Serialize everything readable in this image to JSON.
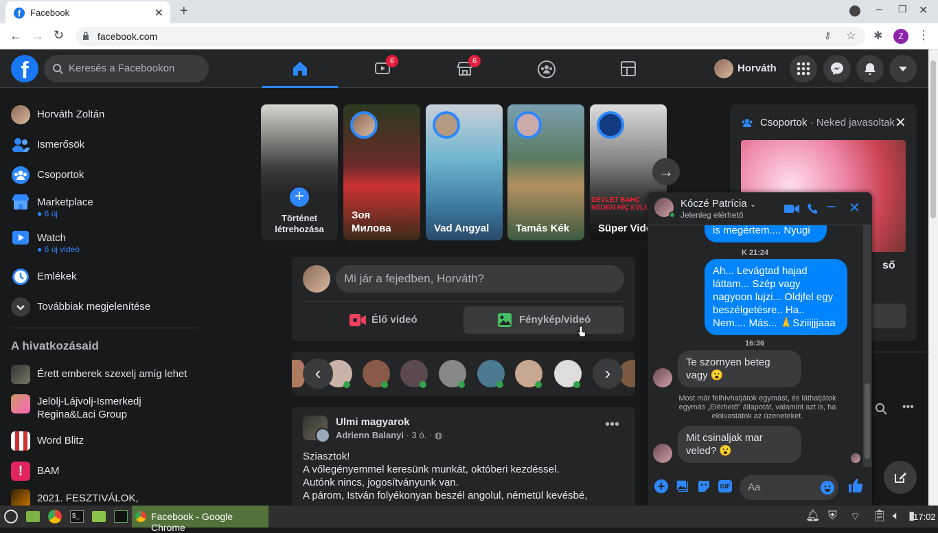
{
  "browser": {
    "tab_title": "Facebook",
    "url": "facebook.com",
    "profile_initial": "Z"
  },
  "header": {
    "search_placeholder": "Keresés a Facebookon",
    "watch_badge": "6",
    "marketplace_badge": "6",
    "user_name": "Horváth"
  },
  "sidebar": {
    "items": [
      {
        "label": "Horváth Zoltán",
        "sub": ""
      },
      {
        "label": "Ismerősök",
        "sub": ""
      },
      {
        "label": "Csoportok",
        "sub": ""
      },
      {
        "label": "Marketplace",
        "sub": "6 új"
      },
      {
        "label": "Watch",
        "sub": "6 új videó"
      },
      {
        "label": "Emlékek",
        "sub": ""
      },
      {
        "label": "Továbbiak megjelenítése",
        "sub": ""
      }
    ],
    "shortcuts_title": "A hivatkozásaid",
    "shortcuts": [
      "Érett emberek szexelj amíg lehet",
      "Jelölj-Lájvolj-Ismerkedj",
      "Regina&Laci Group",
      "Word Blitz",
      "BAM",
      "2021. FESZTIVÁLOK,"
    ]
  },
  "stories": [
    {
      "name1": "Történet",
      "name2": "létrehozása"
    },
    {
      "name1": "Зоя",
      "name2": "Милова"
    },
    {
      "name1": "Vad Angyal",
      "name2": ""
    },
    {
      "name1": "Tamás Kék",
      "name2": ""
    },
    {
      "name1": "Süper Vide",
      "name2": ""
    }
  ],
  "story_texts": {
    "overlay1": "DEVLET BAHÇ",
    "overlay2": "NEDEN HİÇ EVLEN"
  },
  "composer": {
    "placeholder": "Mi jár a fejedben, Horváth?",
    "live_label": "Élő videó",
    "photo_label": "Fénykép/videó"
  },
  "post": {
    "group": "Ulmi magyarok",
    "author": "Adrienn Balanyi",
    "time": "3 ó.",
    "line1": "Sziasztok!",
    "line2": "A vőlegényemmel keresünk munkát, októberi kezdéssel.",
    "line3": "Autónk nincs, jogosítványunk van.",
    "line4": "A párom, István folyékonyan beszél angolul, németül kevésbé,"
  },
  "right": {
    "groups_title": "Csoportok",
    "groups_sub": " · Neked javasoltak",
    "peek_text": "ső"
  },
  "chat": {
    "name": "Kóczé Patrícia",
    "status": "Jelenleg elérhető",
    "msg_top": "is megértem.... Nyugi",
    "ts1": "K 21:24",
    "msg_out": "Ah... Levágtad hajad láttam... Szép vagy nagyoon lujzi... Oldjfel egy beszélgetésre.. Ha.. Nem.... Más... 🙏Sziiijjjaaa",
    "ts2": "16:36",
    "msg_in1": "Te szornyen beteg vagy 😮",
    "system": "Most már felhívhatjátok egymást, és láthatjátok egymás „Elérhető” állapotát, valamint azt is, ha elolvastátok az üzeneteket.",
    "msg_in2": "Mit csinaljak mar veled? 😮",
    "input_placeholder": "Aa"
  },
  "taskbar": {
    "chrome_label": "Facebook - Google Chrome",
    "clock": "17:02"
  },
  "colors": {
    "fb_blue": "#1877f2",
    "accent": "#2d88ff",
    "messenger_blue": "#0084ff",
    "bg": "#18191a",
    "card": "#242526",
    "badge": "#e41e3f",
    "online": "#31a24c"
  }
}
